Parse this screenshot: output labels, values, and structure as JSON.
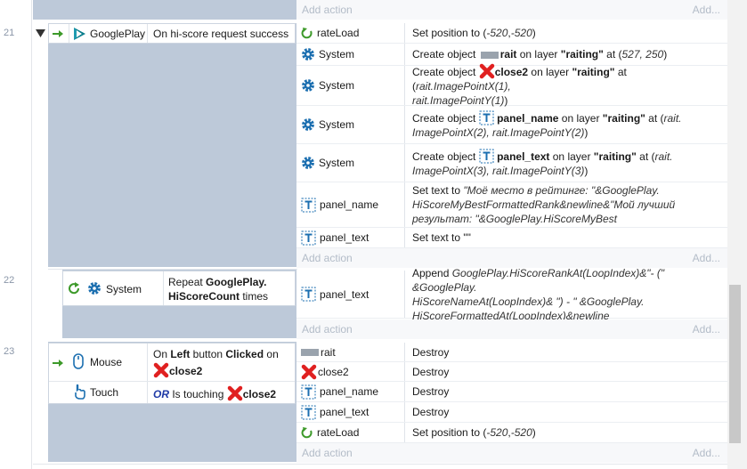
{
  "colors": {
    "event_block": "#bdc9d9",
    "gear": "#1c6fb0",
    "green_arrow": "#3d9a2a",
    "red_x": "#e02020",
    "add_text": "#b3bcc8"
  },
  "common": {
    "add_action": "Add action",
    "add_right": "Add..."
  },
  "events": [
    {
      "number": "21",
      "condition": {
        "object": "GooglePlay",
        "text": "On hi-score request success"
      },
      "actions": [
        {
          "object": "rateLoad",
          "icon": "rateload-icon",
          "text_parts": [
            "Set position to (",
            "-520",
            ", ",
            "-520",
            ")"
          ]
        },
        {
          "object": "System",
          "icon": "gear-icon"
        },
        {
          "object": "System",
          "icon": "gear-icon"
        },
        {
          "object": "System",
          "icon": "gear-icon"
        },
        {
          "object": "System",
          "icon": "gear-icon"
        },
        {
          "object": "panel_name",
          "icon": "text-object-icon"
        },
        {
          "object": "panel_text",
          "icon": "text-object-icon",
          "text": "Set text to \"\""
        }
      ],
      "a1": {
        "pre": "Create object ",
        "obj": "rait",
        "mid": " on layer ",
        "layer": "\"raiting\"",
        "at": " at (",
        "pos": "527, 250",
        "end": ")"
      },
      "a2": {
        "pre": "Create object ",
        "obj": "close2",
        "mid": " on layer ",
        "layer": "\"raiting\"",
        "at": " at (",
        "expr1": "rait.ImagePointX(1),",
        "expr2": "rait.ImagePointY(1)",
        "end": ")"
      },
      "a3": {
        "pre": "Create object ",
        "obj": "panel_name",
        "mid": " on layer ",
        "layer": "\"raiting\"",
        "at": " at (",
        "expr1": "rait.",
        "expr2": "ImagePointX(2), rait.ImagePointY(2)",
        "end": ")"
      },
      "a4": {
        "pre": "Create object ",
        "obj": "panel_text",
        "mid": " on layer ",
        "layer": "\"raiting\"",
        "at": " at (",
        "expr1": "rait.",
        "expr2": "ImagePointX(3), rait.ImagePointY(3)",
        "end": ")"
      },
      "a5": {
        "pre": "Set text to ",
        "l1": "\"Моё место в рейтинге: \"&GooglePlay.",
        "l2": "HiScoreMyBestFormattedRank&newline&\"Мой лучший",
        "l3": "результат: \"&GooglePlay.HiScoreMyBest"
      }
    },
    {
      "number": "22",
      "condition": {
        "object": "System",
        "pre": "Repeat ",
        "expr1": "GooglePlay.",
        "expr2": "HiScoreCount",
        "post": " times"
      },
      "actions": [
        {
          "object": "panel_text",
          "icon": "text-object-icon"
        }
      ],
      "a0": {
        "pre": "Append ",
        "l1": "GooglePlay.HiScoreRankAt(LoopIndex)&\"- (\" &GooglePlay.",
        "l2": "HiScoreNameAt(LoopIndex)& \") - \" &GooglePlay.",
        "l3": "HiScoreFormattedAt(LoopIndex)&newline"
      }
    },
    {
      "number": "23",
      "conditions": [
        {
          "object": "Mouse",
          "pre": "On ",
          "btn": "Left",
          "mid": " button ",
          "act": "Clicked",
          "post": " on",
          "target": "close2"
        },
        {
          "object": "Touch",
          "or": "OR",
          "pre": " Is touching ",
          "target": "close2"
        }
      ],
      "actions": [
        {
          "object": "rait",
          "icon": "rait-sprite-icon",
          "text": "Destroy"
        },
        {
          "object": "close2",
          "icon": "close2-icon",
          "text": "Destroy"
        },
        {
          "object": "panel_name",
          "icon": "text-object-icon",
          "text": "Destroy"
        },
        {
          "object": "panel_text",
          "icon": "text-object-icon",
          "text": "Destroy"
        },
        {
          "object": "rateLoad",
          "icon": "rateload-icon",
          "text_parts": [
            "Set position to (",
            "-520",
            ", ",
            "-520",
            ")"
          ]
        }
      ]
    }
  ]
}
